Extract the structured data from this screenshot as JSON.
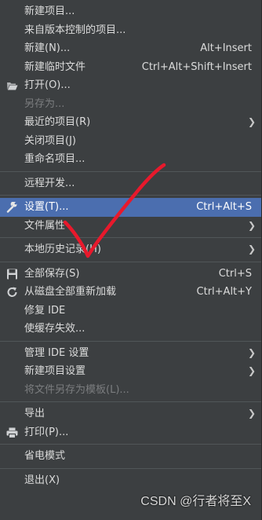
{
  "menu": {
    "new_project": "新建项目...",
    "from_vcs": "来自版本控制的项目...",
    "new": "新建(N)...",
    "new_shortcut": "Alt+Insert",
    "new_scratch": "新建临时文件",
    "new_scratch_shortcut": "Ctrl+Alt+Shift+Insert",
    "open": "打开(O)...",
    "save_as": "另存为...",
    "recent": "最近的项目(R)",
    "close_project": "关闭项目(J)",
    "rename_project": "重命名项目...",
    "remote_dev": "远程开发...",
    "settings": "设置(T)...",
    "settings_shortcut": "Ctrl+Alt+S",
    "file_props": "文件属性",
    "local_history": "本地历史记录(H)",
    "save_all": "全部保存(S)",
    "save_all_shortcut": "Ctrl+S",
    "reload": "从磁盘全部重新加载",
    "reload_shortcut": "Ctrl+Alt+Y",
    "repair_ide": "修复 IDE",
    "invalidate_caches": "使缓存失效...",
    "manage_ide": "管理 IDE 设置",
    "new_project_settings": "新建项目设置",
    "save_as_template": "将文件另存为模板(L)...",
    "export": "导出",
    "print": "打印(P)...",
    "power_save": "省电模式",
    "exit": "退出(X)"
  },
  "icons": {
    "open": "folder-open-icon",
    "settings": "wrench-icon",
    "save_all": "floppy-disk-icon",
    "reload": "refresh-icon",
    "print": "printer-icon"
  },
  "colors": {
    "background": "#3c3f41",
    "selection": "#4b6eaf",
    "annotation": "#e8192c"
  },
  "watermark": "CSDN @行者将至X"
}
